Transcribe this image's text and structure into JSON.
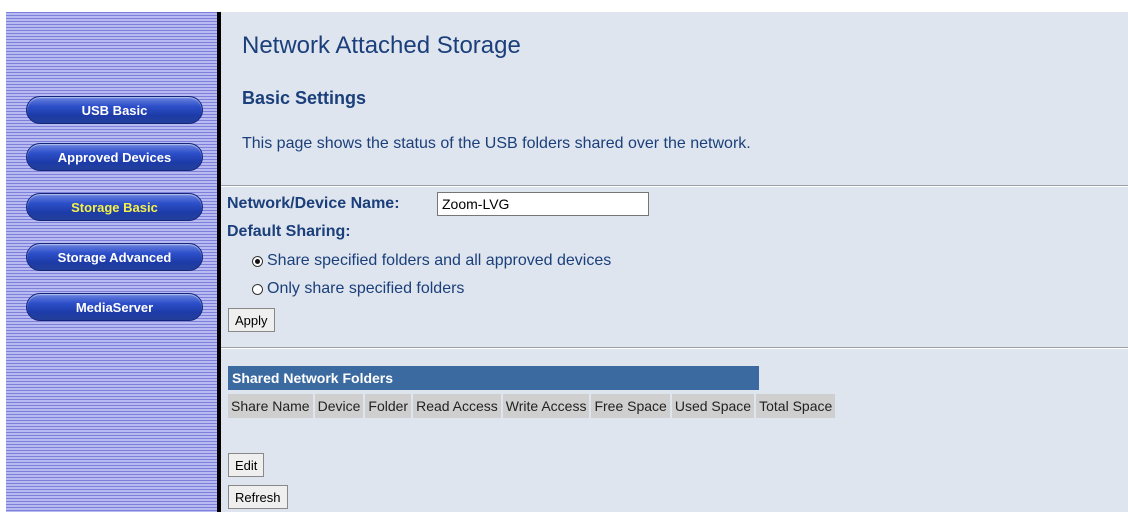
{
  "sidebar": {
    "items": [
      {
        "label": "USB Basic",
        "active": false
      },
      {
        "label": "Approved Devices",
        "active": false
      },
      {
        "label": "Storage Basic",
        "active": true
      },
      {
        "label": "Storage Advanced",
        "active": false
      },
      {
        "label": "MediaServer",
        "active": false
      }
    ]
  },
  "main": {
    "page_title": "Network Attached Storage",
    "section_title": "Basic Settings",
    "intro": "This page shows the status of the USB folders shared over the network.",
    "device_name_label": "Network/Device Name:",
    "device_name_value": "Zoom-LVG",
    "default_sharing_label": "Default Sharing:",
    "sharing_options": [
      {
        "label": "Share specified folders and all approved devices",
        "checked": true
      },
      {
        "label": "Only share specified folders",
        "checked": false
      }
    ],
    "apply_label": "Apply",
    "folders": {
      "title": "Shared Network Folders",
      "columns": [
        "Share Name",
        "Device",
        "Folder",
        "Read Access",
        "Write Access",
        "Free Space",
        "Used Space",
        "Total Space"
      ]
    },
    "edit_label": "Edit",
    "refresh_label": "Refresh"
  },
  "colors": {
    "title_blue": "#1a3f7a",
    "panel_bg": "#dfe5ee",
    "table_header": "#3a6aa0",
    "active_nav_text": "#f4f04a"
  }
}
